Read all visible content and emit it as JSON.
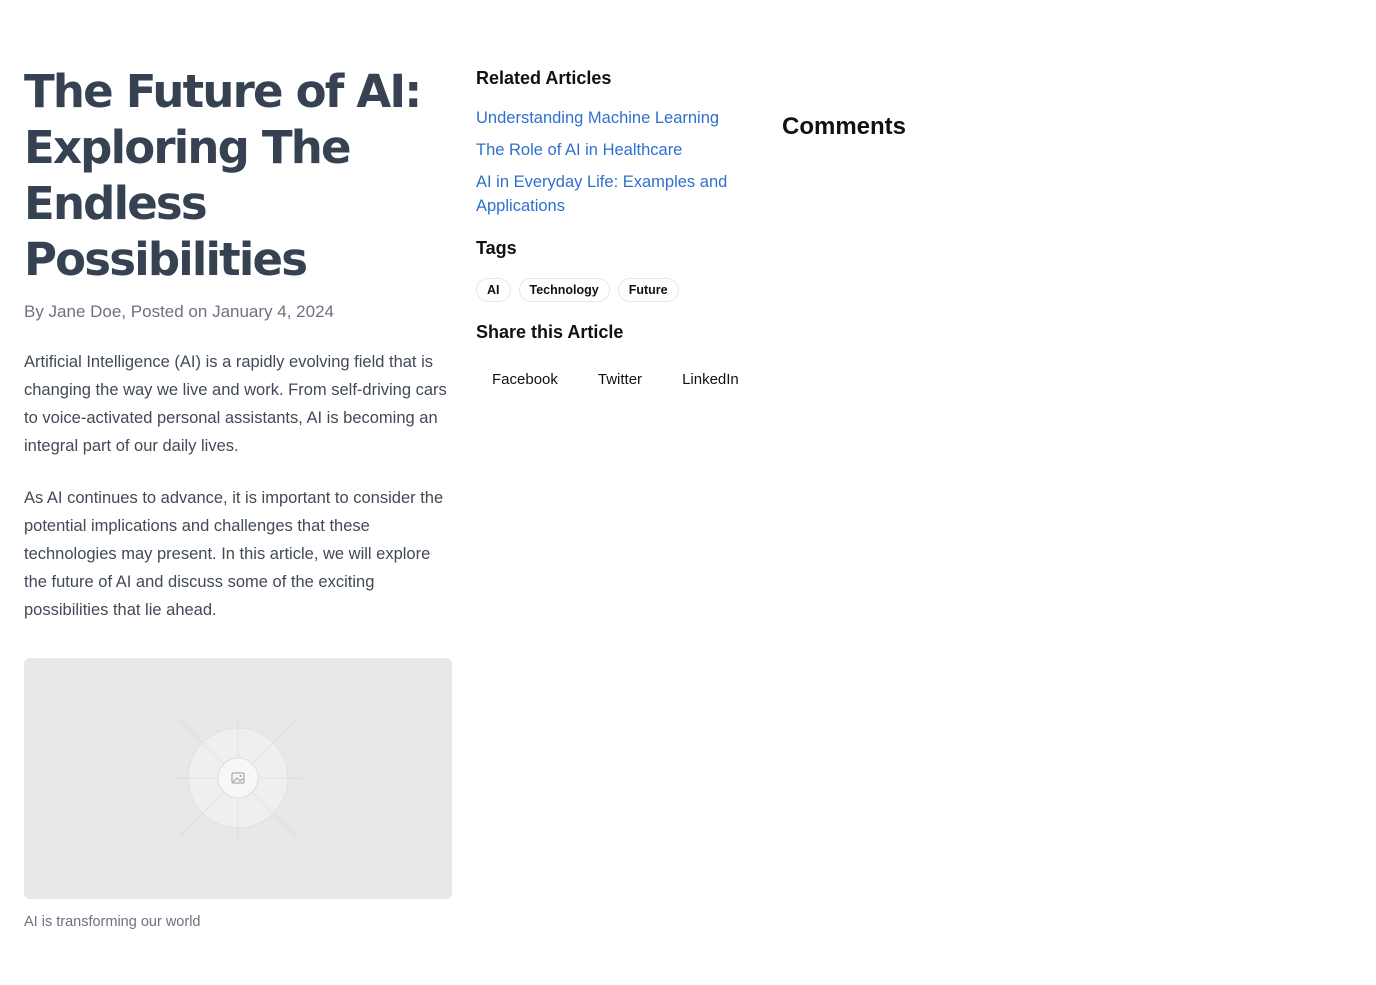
{
  "article": {
    "title": "The Future of AI: Exploring The Endless Possibilities",
    "byline": "By Jane Doe, Posted on January 4, 2024",
    "paragraphs": [
      "Artificial Intelligence (AI) is a rapidly evolving field that is changing the way we live and work. From self-driving cars to voice-activated personal assistants, AI is becoming an integral part of our daily lives.",
      "As AI continues to advance, it is important to consider the potential implications and challenges that these technologies may present. In this article, we will explore the future of AI and discuss some of the exciting possibilities that lie ahead."
    ],
    "image": {
      "icon": "image-icon",
      "caption": "AI is transforming our world"
    }
  },
  "sidebar": {
    "related_heading": "Related Articles",
    "related": [
      "Understanding Machine Learning",
      "The Role of AI in Healthcare",
      "AI in Everyday Life: Examples and Applications"
    ],
    "tags_heading": "Tags",
    "tags": [
      "AI",
      "Technology",
      "Future"
    ],
    "share_heading": "Share this Article",
    "share": [
      "Facebook",
      "Twitter",
      "LinkedIn"
    ]
  },
  "comments": {
    "heading": "Comments"
  },
  "colors": {
    "title": "#364152",
    "link": "#2f6fd0",
    "muted": "#6b7280",
    "image_placeholder": "#e8e8e8"
  }
}
